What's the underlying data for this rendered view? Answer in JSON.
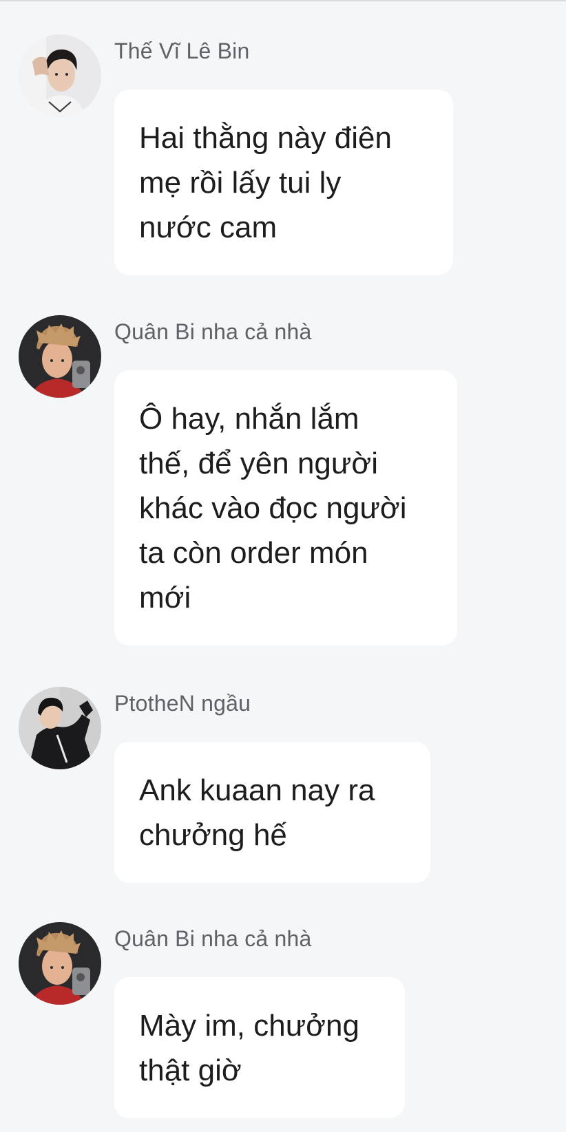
{
  "messages": [
    {
      "sender": "Thế Vĩ Lê Bin",
      "avatar_icon": "profile-photo-young-man-hand-on-head",
      "lines": [
        "Hai thằng này điên",
        "mẹ rồi lấy tui ly",
        "nước cam"
      ]
    },
    {
      "sender": "Quân Bi nha cả nhà",
      "avatar_icon": "profile-photo-man-mirror-selfie",
      "lines": [
        "Ô hay, nhắn lắm",
        "thế, để yên người",
        "khác vào đọc người",
        "ta còn order món",
        "mới"
      ]
    },
    {
      "sender": "PtotheN ngầu",
      "avatar_icon": "profile-photo-man-black-jacket",
      "lines": [
        "Ank kuaan nay ra",
        "chưởng hế"
      ]
    },
    {
      "sender": "Quân Bi nha cả nhà",
      "avatar_icon": "profile-photo-man-mirror-selfie",
      "lines": [
        "Mày im, chưởng",
        "thật giờ"
      ]
    }
  ],
  "colors": {
    "background": "#f5f6f8",
    "bubble": "#ffffff",
    "sender_text": "#5e6166",
    "message_text": "#1c1d1f"
  }
}
